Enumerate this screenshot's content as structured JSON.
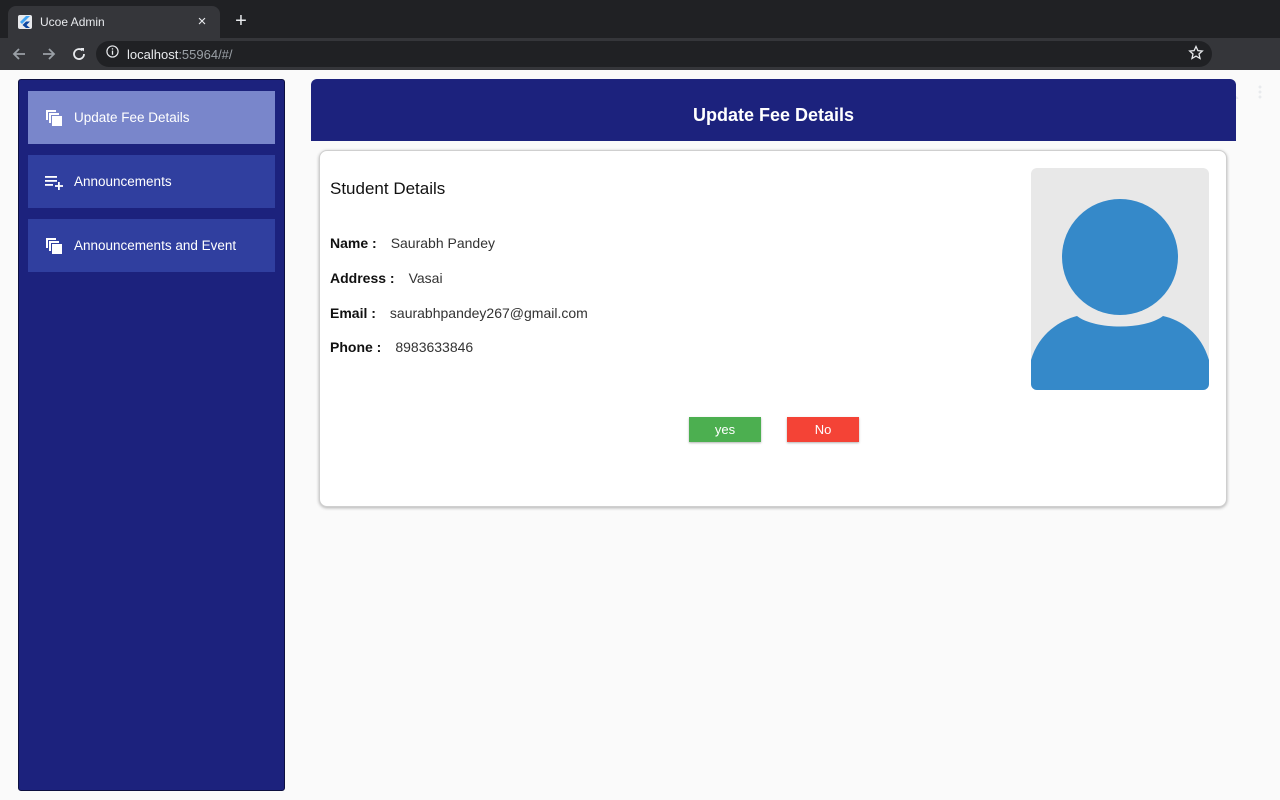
{
  "browser": {
    "tab_title": "Ucoe Admin",
    "tab_close": "×",
    "new_tab": "+",
    "url_host": "localhost",
    "url_rest": ":55964/#/"
  },
  "sidebar": {
    "items": [
      {
        "label": "Update Fee Details",
        "icon": "copy-icon",
        "active": true
      },
      {
        "label": "Announcements",
        "icon": "playlist-add-icon",
        "active": false
      },
      {
        "label": "Announcements and Event",
        "icon": "copy-icon",
        "active": false
      }
    ]
  },
  "header": {
    "title": "Update Fee Details"
  },
  "card": {
    "title": "Student Details",
    "fields": [
      {
        "label": "Name :",
        "value": "Saurabh Pandey"
      },
      {
        "label": "Address :",
        "value": "Vasai"
      },
      {
        "label": "Email :",
        "value": "saurabhpandey267@gmail.com"
      },
      {
        "label": "Phone :",
        "value": "8983633846"
      }
    ],
    "yes_label": "yes",
    "no_label": "No"
  },
  "colors": {
    "sidebar_bg": "#1c227d",
    "nav_item": "#303f9f",
    "nav_item_active": "#7986cb",
    "yes": "#4caf50",
    "no": "#f44336",
    "avatar": "#3589c9"
  }
}
